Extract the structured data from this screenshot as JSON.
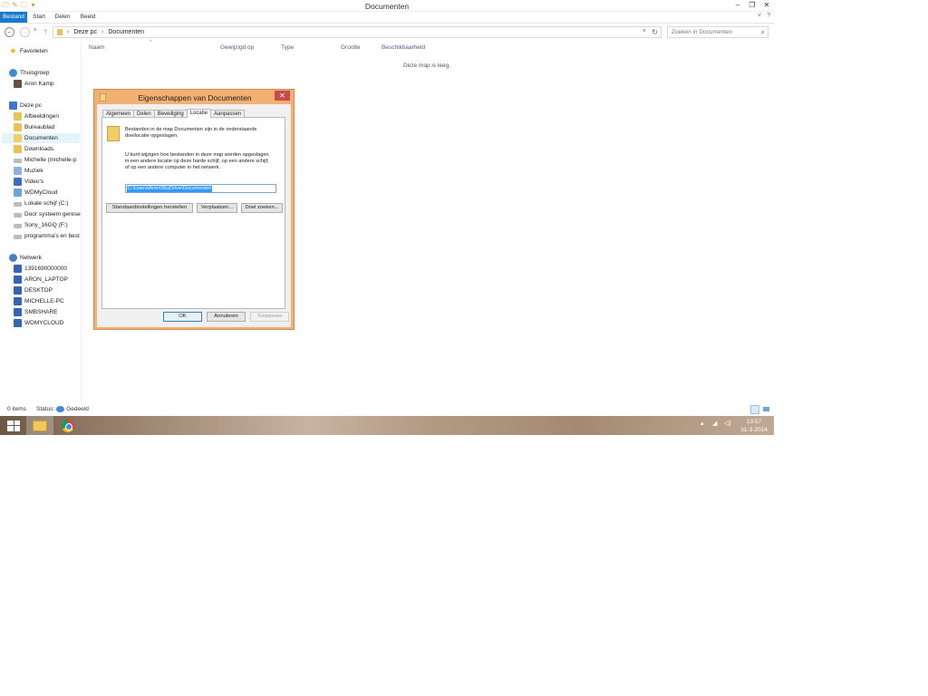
{
  "window": {
    "title": "Documenten",
    "controls": [
      "–",
      "❐",
      "✕"
    ],
    "quick_access": [
      "🗁",
      "✎",
      "🗀",
      "▾"
    ]
  },
  "ribbon": {
    "tabs": [
      "Bestand",
      "Start",
      "Delen",
      "Beeld"
    ],
    "right": [
      "˅",
      "?"
    ]
  },
  "address": {
    "back": "←",
    "forward": "→",
    "history": "˅",
    "up": "↑",
    "crumbs": [
      "Deze pc",
      "Documenten"
    ],
    "separator": "›",
    "dropdown": "˅",
    "refresh": "↻",
    "search_placeholder": "Zoeken in Documenten",
    "search_icon": "⌕"
  },
  "nav": {
    "favorites": "Favorieten",
    "homegroup": "Thuisgroep",
    "homegroup_user": "Aron Kamp",
    "this_pc": "Deze pc",
    "pc_items": [
      "Afbeeldingen",
      "Bureaublad",
      "Documenten",
      "Downloads",
      "Michelle (michelle-p",
      "Muziek",
      "Video's",
      "WDMyCloud",
      "Lokale schijf (C:)",
      "Door systeem gerese",
      "Sony_16GQ (F:)",
      "programma's en best"
    ],
    "network": "Netwerk",
    "network_items": [
      "1391690000000",
      "ARON_LAPTOP",
      "DESKTOP",
      "MICHELLE-PC",
      "SMBSHARE",
      "WDMYCLOUD"
    ]
  },
  "content": {
    "columns": [
      "Naam",
      "Gewijzigd op",
      "Type",
      "Grootte",
      "Beschikbaarheid"
    ],
    "sort_indicator": "^",
    "empty_message": "Deze map is leeg."
  },
  "status": {
    "items": "0 items",
    "state_label": "Status:",
    "state_value": "Gedeeld"
  },
  "taskbar": {
    "tray_arrow": "▴",
    "tray_signal": "◢",
    "tray_sound": "◁)",
    "time": "13:57",
    "date": "31-3-2014"
  },
  "dialog": {
    "title": "Eigenschappen van Documenten",
    "close": "✕",
    "tabs": [
      "Algemeen",
      "Delen",
      "Beveiliging",
      "Locatie",
      "Aanpassen"
    ],
    "active_tab": "Locatie",
    "info_line1": "Bestanden in de map Documenten zijn in de onderstaande",
    "info_line2": "doellocatie opgeslagen.",
    "change_line1": "U kunt wijzigen hoe bestanden in deze map worden opgeslagen",
    "change_line2": "in een andere locatie op deze harde schijf, op een andere schijf,",
    "change_line3": "of op een andere computer in het netwerk.",
    "path": "C:\\Users\\Aron\\SkyDrive\\Documenten",
    "btn_restore": "Standaardinstellingen herstellen",
    "btn_move": "Verplaatsen...",
    "btn_find": "Doel zoeken...",
    "btn_ok": "OK",
    "btn_cancel": "Annuleren",
    "btn_apply": "Toepassen"
  },
  "colors": {
    "accent": "#1979ca",
    "dialog_frame": "#f3b073",
    "close_red": "#c74b4b",
    "selection": "#3399ff"
  }
}
